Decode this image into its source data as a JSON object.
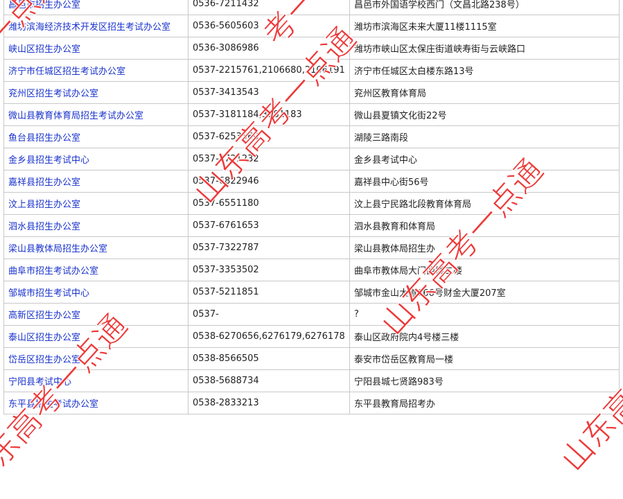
{
  "rows": [
    {
      "office": "昌邑市招生办公室",
      "phone": "0536-7211432",
      "address": "昌邑市外国语学校西门（文昌北路238号）"
    },
    {
      "office": "潍坊滨海经济技术开发区招生考试办公室",
      "phone": "0536-5605603",
      "address": "潍坊市滨海区未来大厦11楼1115室"
    },
    {
      "office": "峡山区招生办公室",
      "phone": "0536-3086986",
      "address": "潍坊市峡山区太保庄街道峡寿街与云峡路口"
    },
    {
      "office": "济宁市任城区招生考试办公室",
      "phone": "0537-2215761,2106680,2106191",
      "address": "济宁市任城区太白楼东路13号"
    },
    {
      "office": "兖州区招生考试办公室",
      "phone": "0537-3413543",
      "address": "兖州区教育体育局"
    },
    {
      "office": "微山县教育体育局招生考试办公室",
      "phone": "0537-3181184,3181183",
      "address": "微山县夏镇文化街22号"
    },
    {
      "office": "鱼台县招生办公室",
      "phone": "0537-6253560",
      "address": "湖陵三路南段"
    },
    {
      "office": "金乡县招生考试中心",
      "phone": "0537-8721232",
      "address": "金乡县考试中心"
    },
    {
      "office": "嘉祥县招生办公室",
      "phone": "0537-6822946",
      "address": "嘉祥县中心街56号"
    },
    {
      "office": "汶上县招生办公室",
      "phone": "0537-6551180",
      "address": "汶上县宁民路北段教育体育局"
    },
    {
      "office": "泗水县招生办公室",
      "phone": "0537-6761653",
      "address": "泗水县教育和体育局"
    },
    {
      "office": "梁山县教体局招生办公室",
      "phone": "0537-7322787",
      "address": "梁山县教体局招生办"
    },
    {
      "office": "曲阜市招生考试办公室",
      "phone": "0537-3353502",
      "address": "曲阜市教体局大门西楼二楼"
    },
    {
      "office": "邹城市招生考试中心",
      "phone": "0537-5211851",
      "address": "邹城市金山大道666号财金大厦207室"
    },
    {
      "office": "高新区招生办公室",
      "phone": "0537-",
      "address": "?"
    },
    {
      "office": "泰山区招生办公室",
      "phone": "0538-6270656,6276179,6276178",
      "address": "泰山区政府院内4号楼三楼"
    },
    {
      "office": "岱岳区招生办公室",
      "phone": "0538-8566505",
      "address": "泰安市岱岳区教育局一楼"
    },
    {
      "office": "宁阳县考试中心",
      "phone": "0538-5688734",
      "address": "宁阳县城七贤路983号"
    },
    {
      "office": "东平县招生考试办公室",
      "phone": "0538-2833213",
      "address": "东平县教育局招考办"
    }
  ],
  "watermark": {
    "text_full": "山东高考一点通",
    "text_partial_1": "考一点",
    "text_partial_2": "一点通",
    "text_partial_3": "山东高考",
    "text_partial_4": "山东高考一点通",
    "color": "#eb2828"
  },
  "colors": {
    "link": "#1a33cc",
    "border": "#c8c8c8"
  }
}
